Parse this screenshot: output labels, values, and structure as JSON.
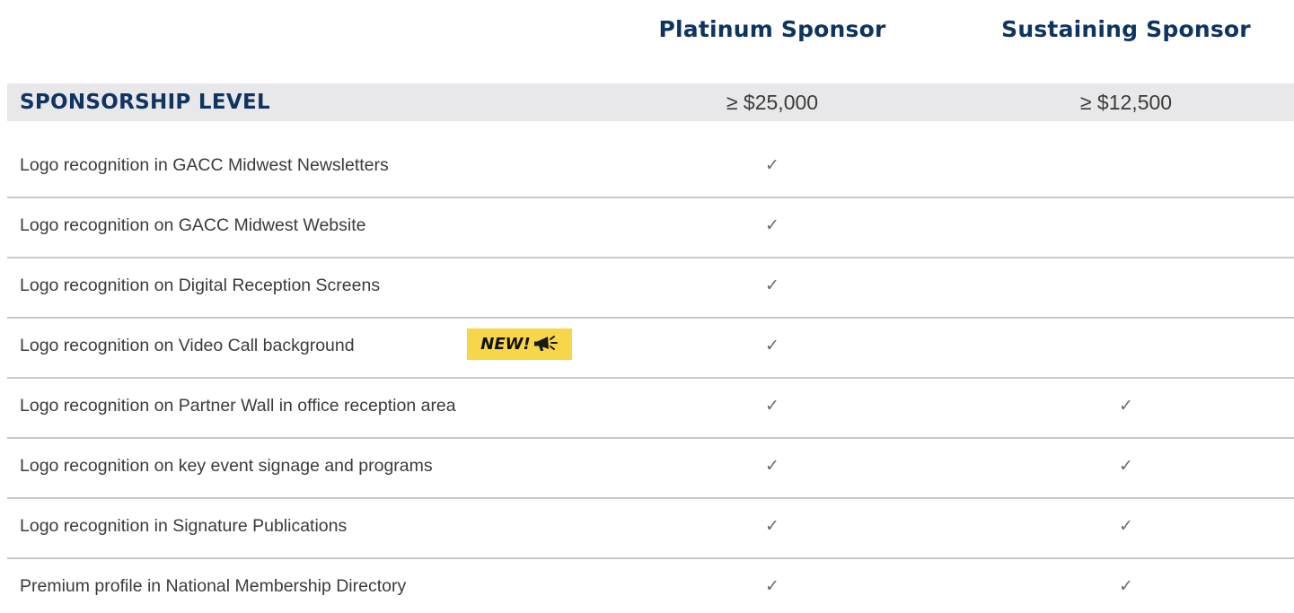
{
  "columns": {
    "platinum": "Platinum Sponsor",
    "sustaining": "Sustaining Sponsor"
  },
  "level": {
    "label": "SPONSORSHIP LEVEL",
    "platinum": "≥ $25,000",
    "sustaining": "≥ $12,500"
  },
  "check_symbol": "✓",
  "badge": {
    "text": "NEW!",
    "icon": "megaphone-icon"
  },
  "benefits": [
    {
      "label": "Logo recognition in GACC Midwest Newsletters",
      "platinum": "✓",
      "sustaining": ""
    },
    {
      "label": "Logo recognition on GACC Midwest Website",
      "platinum": "✓",
      "sustaining": ""
    },
    {
      "label": "Logo recognition on Digital Reception Screens",
      "platinum": "✓",
      "sustaining": ""
    },
    {
      "label": "Logo recognition on Video Call background",
      "platinum": "✓",
      "sustaining": ""
    },
    {
      "label": "Logo recognition on Partner Wall in office reception area",
      "platinum": "✓",
      "sustaining": "✓"
    },
    {
      "label": "Logo recognition on key event signage and programs",
      "platinum": "✓",
      "sustaining": "✓"
    },
    {
      "label": "Logo recognition in Signature Publications",
      "platinum": "✓",
      "sustaining": "✓"
    },
    {
      "label": "Premium profile in National Membership Directory",
      "platinum": "✓",
      "sustaining": "✓"
    }
  ],
  "colors": {
    "heading": "#0f3460",
    "level_band": "#e8e8ea",
    "badge": "#f7d64a",
    "divider": "#c9c9cc"
  }
}
